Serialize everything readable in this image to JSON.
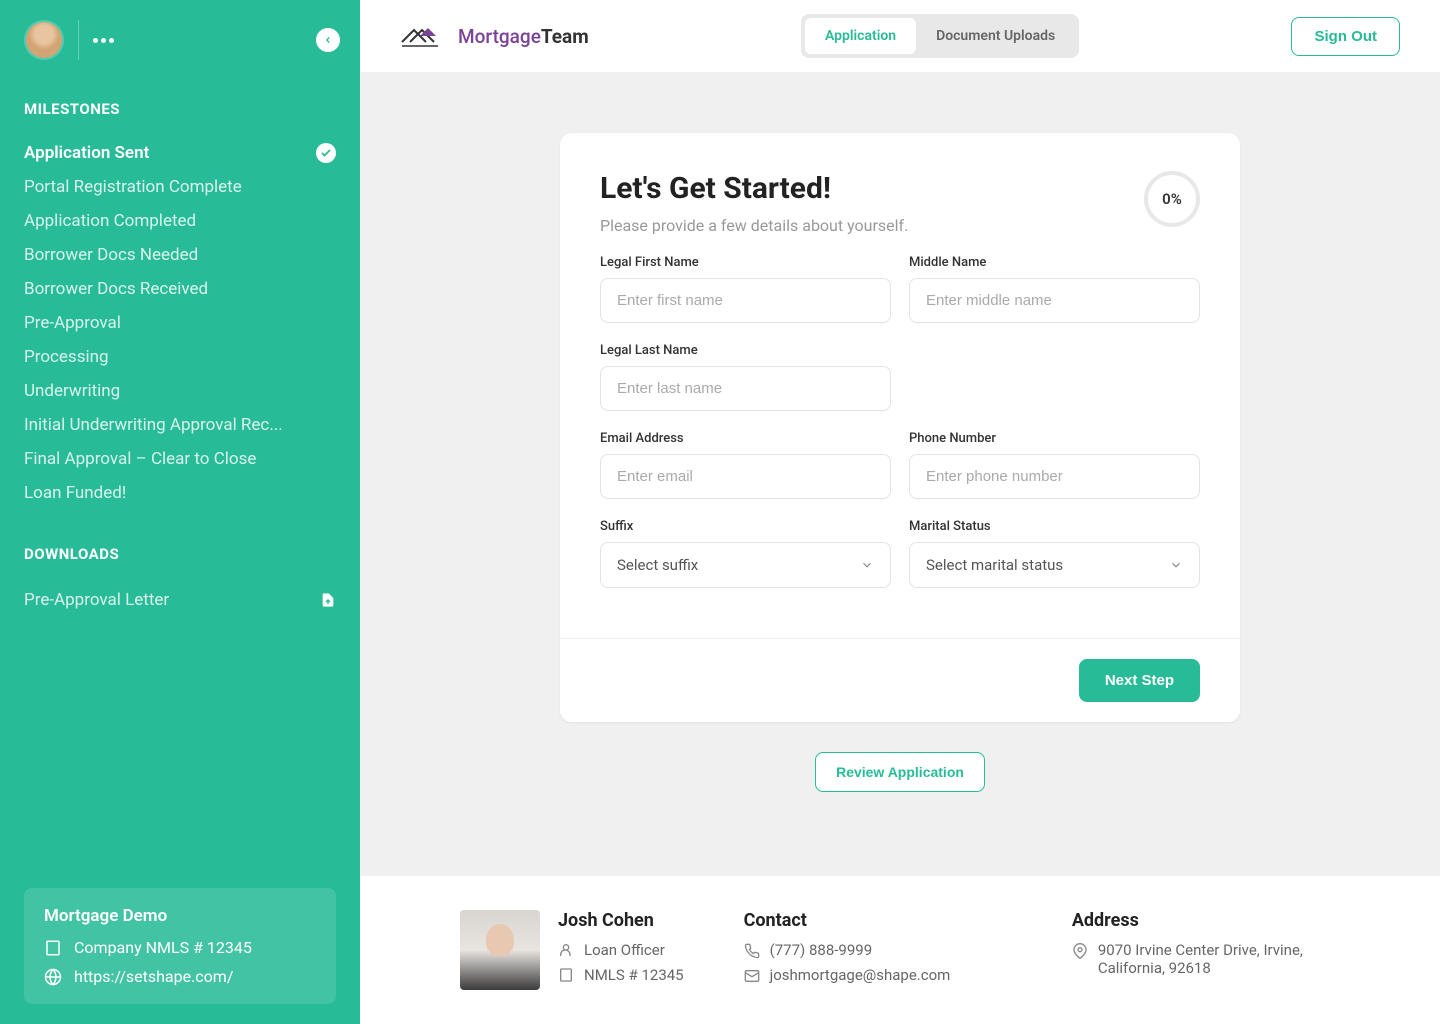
{
  "sidebar": {
    "milestones_title": "MILESTONES",
    "milestones": [
      {
        "label": "Application Sent",
        "active": true,
        "checked": true
      },
      {
        "label": "Portal Registration Complete"
      },
      {
        "label": "Application Completed"
      },
      {
        "label": "Borrower Docs Needed"
      },
      {
        "label": "Borrower Docs Received"
      },
      {
        "label": "Pre-Approval"
      },
      {
        "label": "Processing"
      },
      {
        "label": "Underwriting"
      },
      {
        "label": "Initial Underwriting Approval Rec..."
      },
      {
        "label": "Final Approval – Clear to Close"
      },
      {
        "label": "Loan Funded!"
      }
    ],
    "downloads_title": "DOWNLOADS",
    "downloads": [
      {
        "label": "Pre-Approval Letter"
      }
    ],
    "company": {
      "name": "Mortgage Demo",
      "nmls": "Company NMLS # 12345",
      "url": "https://setshape.com/"
    }
  },
  "header": {
    "logo_text_1": "Mortgage",
    "logo_text_2": "Team",
    "tabs": [
      {
        "label": "Application",
        "active": true
      },
      {
        "label": "Document Uploads"
      }
    ],
    "signout": "Sign Out"
  },
  "form": {
    "title": "Let's Get Started!",
    "subtitle": "Please provide a few details about yourself.",
    "progress": "0%",
    "fields": {
      "first_name": {
        "label": "Legal First Name",
        "placeholder": "Enter first name"
      },
      "middle_name": {
        "label": "Middle Name",
        "placeholder": "Enter middle name"
      },
      "last_name": {
        "label": "Legal Last Name",
        "placeholder": "Enter last name"
      },
      "email": {
        "label": "Email Address",
        "placeholder": "Enter email"
      },
      "phone": {
        "label": "Phone Number",
        "placeholder": "Enter phone number"
      },
      "suffix": {
        "label": "Suffix",
        "placeholder": "Select suffix"
      },
      "marital": {
        "label": "Marital Status",
        "placeholder": "Select marital status"
      }
    },
    "next_button": "Next Step",
    "review_button": "Review Application"
  },
  "footer": {
    "officer": {
      "name": "Josh Cohen",
      "title": "Loan Officer",
      "nmls": "NMLS # 12345"
    },
    "contact": {
      "heading": "Contact",
      "phone": "(777) 888-9999",
      "email": "joshmortgage@shape.com"
    },
    "address": {
      "heading": "Address",
      "text": "9070 Irvine Center Drive, Irvine, California, 92618"
    }
  }
}
